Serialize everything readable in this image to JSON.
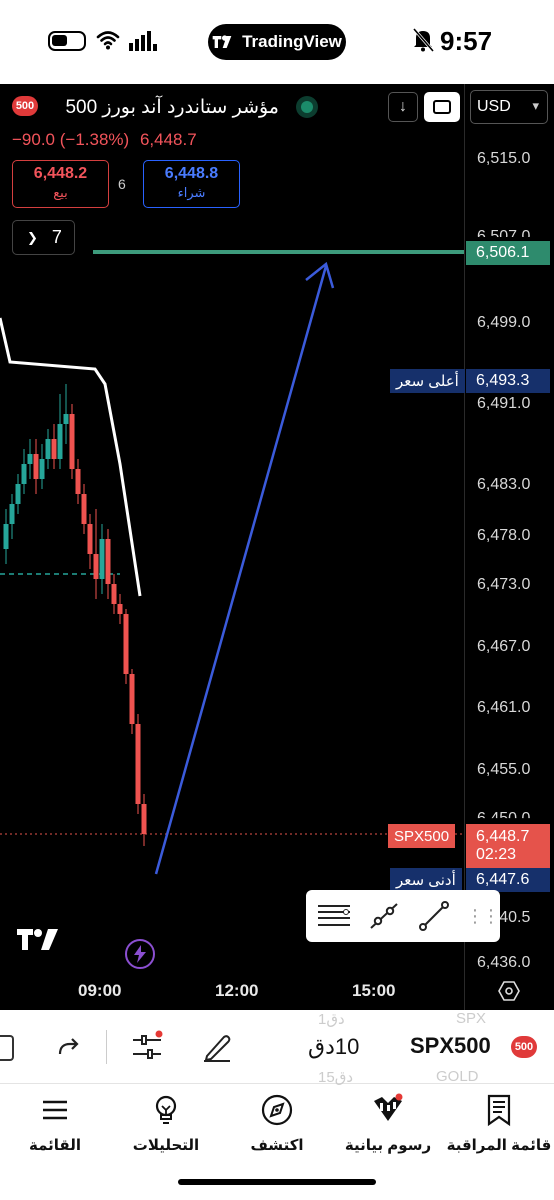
{
  "status_bar": {
    "app_pill": "TradingView",
    "time": "9:57"
  },
  "header": {
    "badge": "500",
    "title": "مؤشر ستاندرد آند بورز 500",
    "change": "−90.0 (−1.38%)",
    "last": "6,448.7",
    "sell_price": "6,448.2",
    "sell_label": "بيع",
    "spread": "6",
    "buy_price": "6,448.8",
    "buy_label": "شراء",
    "collapse_count": "7",
    "currency": "USD"
  },
  "price_axis": {
    "ticks": [
      "6,515.0",
      "6,499.0",
      "6,491.0",
      "6,483.0",
      "6,478.0",
      "6,473.0",
      "6,467.0",
      "6,461.0",
      "6,455.0",
      "6,450.0",
      "6,440.5",
      "6,436.0"
    ],
    "partial_tick": "6,507.0",
    "target_price": "6,506.1",
    "high_price": "6,493.3",
    "high_label": "أعلى سعر",
    "last_price": "6,448.7",
    "countdown": "02:23",
    "symbol_label": "SPX500",
    "low_price": "6,447.6",
    "low_label": "أدنى سعر"
  },
  "time_axis": [
    "09:00",
    "12:00",
    "15:00"
  ],
  "toolbar": {
    "interval": "10دق",
    "interval_above": "1دق",
    "interval_below": "15دق",
    "symbol": "SPX500",
    "symbol_above": "SPX",
    "symbol_below": "GOLD",
    "badge": "500"
  },
  "bottom_nav": [
    {
      "label": "القائمة",
      "icon": "menu-icon"
    },
    {
      "label": "التحليلات",
      "icon": "lightbulb-icon"
    },
    {
      "label": "اكتشف",
      "icon": "compass-icon"
    },
    {
      "label": "رسوم بيانية",
      "icon": "candles-icon"
    },
    {
      "label": "قائمة المراقبة",
      "icon": "bookmark-icon"
    }
  ],
  "colors": {
    "up": "#26a69a",
    "down": "#ef5350",
    "accent_blue": "#2962ff",
    "target_line": "#3d9b7c"
  }
}
